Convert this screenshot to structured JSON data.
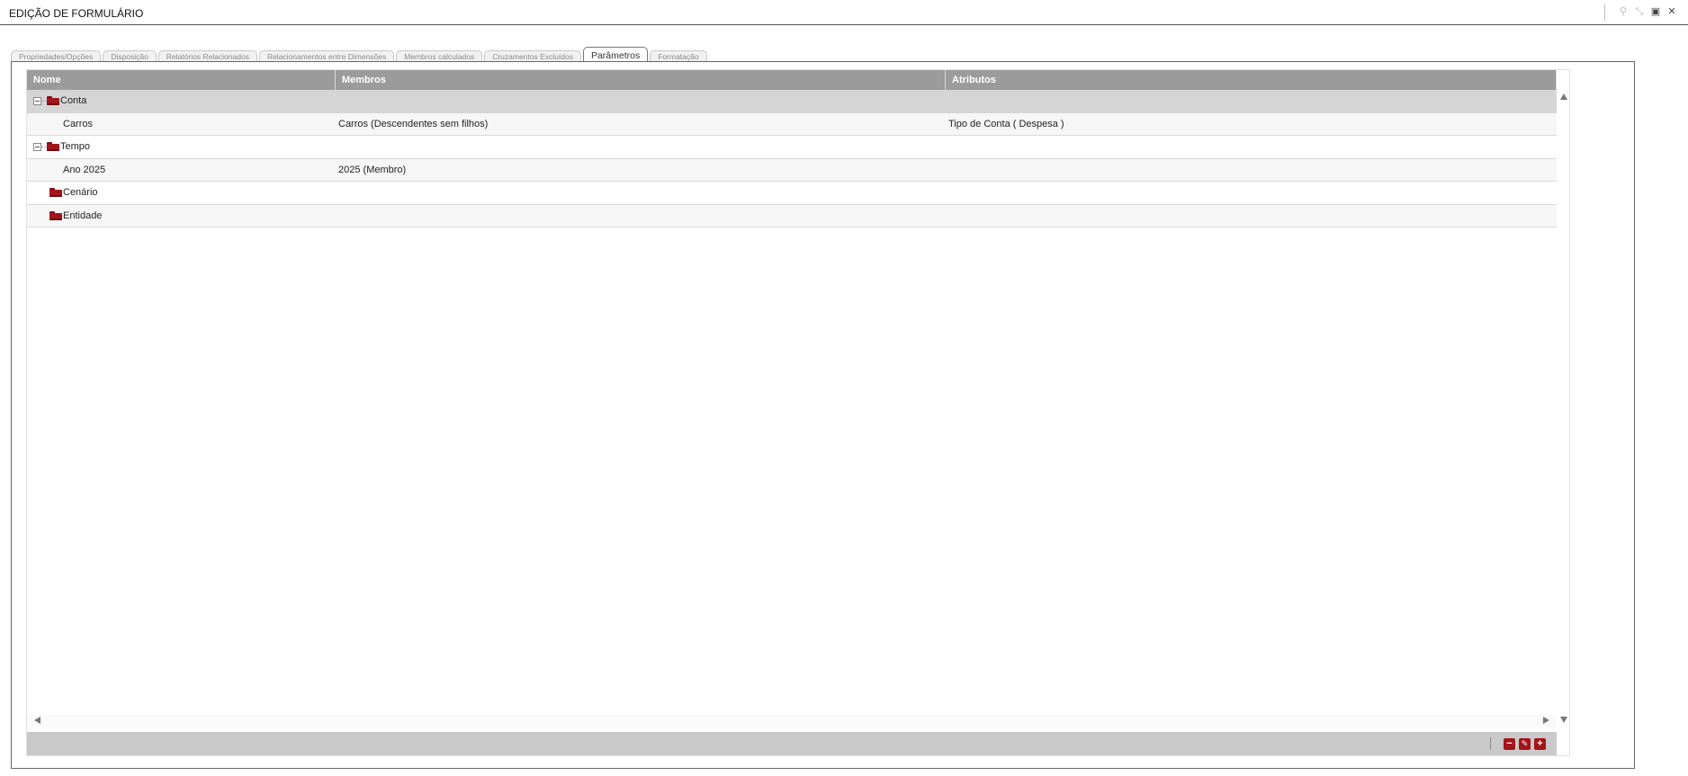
{
  "window": {
    "title": "EDIÇÃO DE FORMULÁRIO",
    "controls": [
      {
        "icon": "pin-icon",
        "glyph": "⚲"
      },
      {
        "icon": "minimize-icon",
        "glyph": "⤡"
      },
      {
        "icon": "maximize-icon",
        "glyph": "▣"
      },
      {
        "icon": "close-icon",
        "glyph": "✕"
      }
    ]
  },
  "tabs": [
    {
      "label": "Propriedades/Opções",
      "active": false
    },
    {
      "label": "Disposição",
      "active": false
    },
    {
      "label": "Relatórios Relacionados",
      "active": false
    },
    {
      "label": "Relacionamentos entre Dimensões",
      "active": false
    },
    {
      "label": "Membros calculados",
      "active": false
    },
    {
      "label": "Cruzamentos Excluídos",
      "active": false
    },
    {
      "label": "Parâmetros",
      "active": true
    },
    {
      "label": "Formatação",
      "active": false
    }
  ],
  "grid": {
    "columns": [
      "Nome",
      "Membros",
      "Atributos"
    ],
    "rows": [
      {
        "type": "group",
        "expandable": true,
        "name": "Conta",
        "members": "",
        "attributes": ""
      },
      {
        "type": "leaf",
        "name": "Carros",
        "members": "Carros (Descendentes sem filhos)",
        "attributes": "Tipo de Conta ( Despesa )"
      },
      {
        "type": "group",
        "expandable": true,
        "name": "Tempo",
        "members": "",
        "attributes": ""
      },
      {
        "type": "leaf",
        "name": "Ano 2025",
        "members": "2025 (Membro)",
        "attributes": ""
      },
      {
        "type": "group",
        "expandable": false,
        "name": "Cenário",
        "members": "",
        "attributes": ""
      },
      {
        "type": "group",
        "expandable": false,
        "name": "Entidade",
        "members": "",
        "attributes": ""
      }
    ]
  },
  "footer": {
    "buttons": [
      {
        "icon": "remove-icon",
        "glyph": "−"
      },
      {
        "icon": "edit-icon",
        "glyph": "✎"
      },
      {
        "icon": "add-icon",
        "glyph": "+"
      }
    ]
  },
  "colors": {
    "accent": "#a3151b",
    "header": "#9b9b9b",
    "group_row": "#d5d5d5"
  }
}
